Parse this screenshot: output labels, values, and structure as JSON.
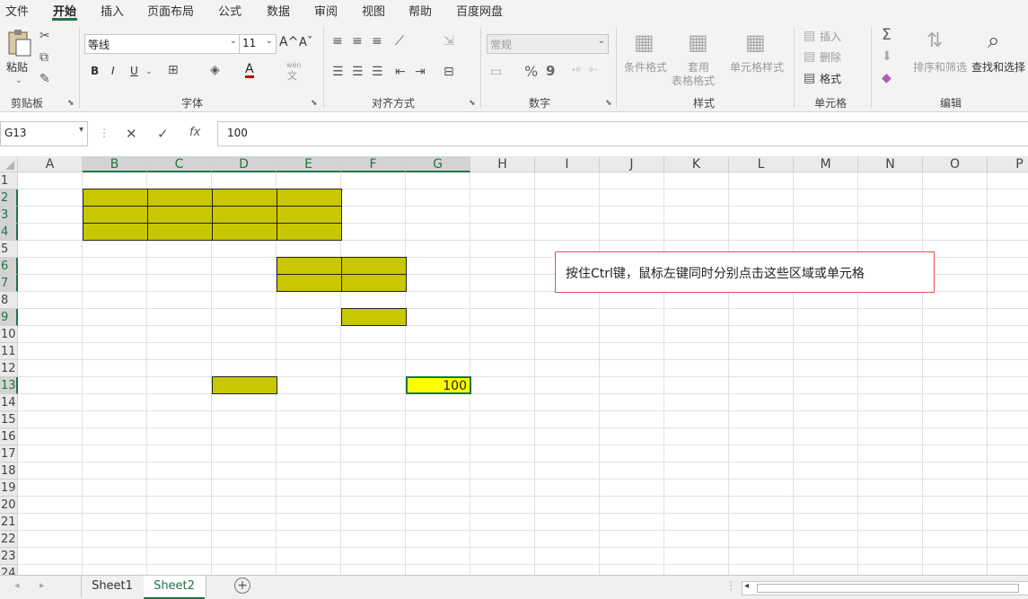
{
  "menu": {
    "tabs": [
      "文件",
      "开始",
      "插入",
      "页面布局",
      "公式",
      "数据",
      "审阅",
      "视图",
      "帮助",
      "百度网盘"
    ],
    "active": "开始"
  },
  "ribbon": {
    "clipboard": {
      "paste": "粘贴",
      "label": "剪贴板"
    },
    "font": {
      "name": "等线",
      "size": "11",
      "bold": "B",
      "italic": "I",
      "underline": "U",
      "grow": "A^",
      "shrink": "Aˇ",
      "color_letter": "A",
      "wen": "wén",
      "wen_char": "文",
      "label": "字体"
    },
    "alignment": {
      "label": "对齐方式"
    },
    "number": {
      "format": "常规",
      "percent": "%",
      "comma": "9",
      "label": "数字"
    },
    "styles": {
      "conditional": "条件格式",
      "table1": "套用",
      "table2": "表格格式",
      "cell_styles": "单元格样式",
      "label": "样式"
    },
    "cells": {
      "insert": "插入",
      "delete": "删除",
      "format": "格式",
      "label": "单元格"
    },
    "editing": {
      "sort": "排序和筛选",
      "find": "查找和选择",
      "label": "编辑"
    }
  },
  "formula_bar": {
    "name_box": "G13",
    "cancel": "✕",
    "enter": "✓",
    "fx": "fx",
    "content": "100"
  },
  "grid": {
    "columns": [
      "A",
      "B",
      "C",
      "D",
      "E",
      "F",
      "G",
      "H",
      "I",
      "J",
      "K",
      "L",
      "M",
      "N",
      "O",
      "P"
    ],
    "rows": [
      "1",
      "2",
      "3",
      "4",
      "5",
      "6",
      "7",
      "8",
      "9",
      "10",
      "11",
      "12",
      "13",
      "14",
      "15",
      "16",
      "17",
      "18",
      "19",
      "20",
      "21",
      "22",
      "23",
      "24"
    ],
    "selected_columns": [
      "B",
      "C",
      "D",
      "E",
      "F",
      "G"
    ],
    "selected_rows": [
      "2",
      "3",
      "4",
      "6",
      "7",
      "9",
      "13"
    ],
    "active_cell_value": "100",
    "fill_color": "#c9c700",
    "active_fill_color": "#ffff00"
  },
  "callout": {
    "text": "按住Ctrl键，鼠标左键同时分别点击这些区域或单元格"
  },
  "sheets": {
    "tabs": [
      "Sheet1",
      "Sheet2"
    ],
    "active": "Sheet2",
    "add": "+"
  },
  "colors": {
    "accent": "#217346",
    "callout_border": "#d9534f"
  }
}
